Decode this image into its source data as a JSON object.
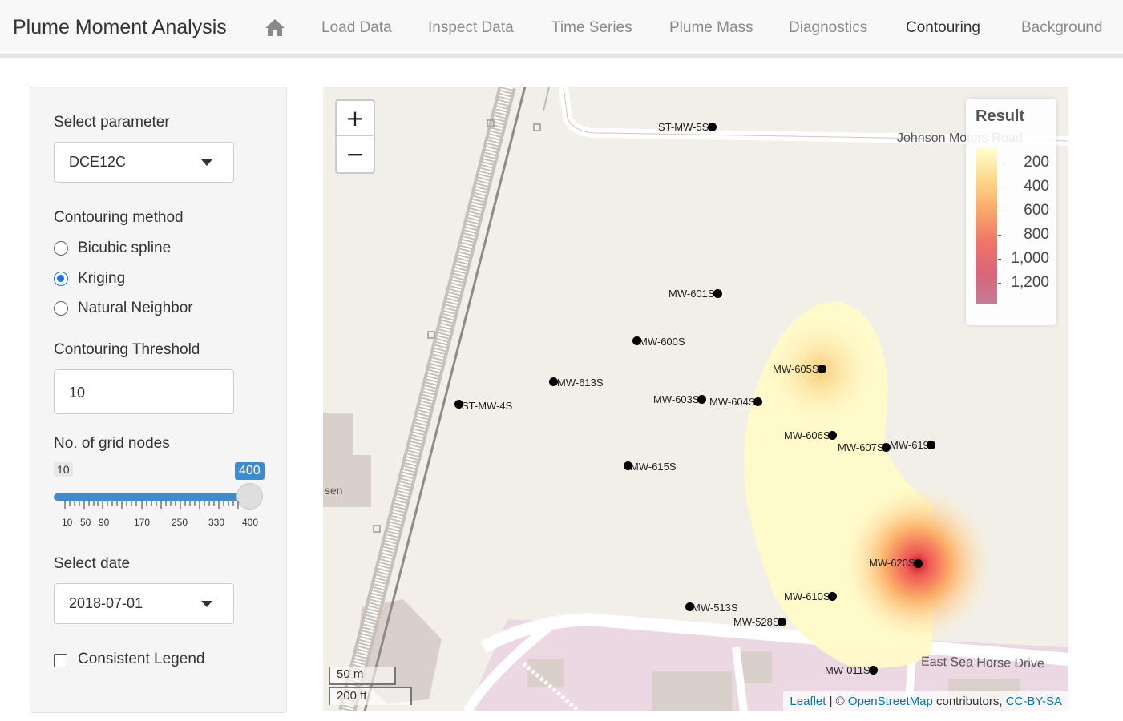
{
  "navbar": {
    "brand": "Plume Moment Analysis",
    "home_icon": "home-icon",
    "items": [
      {
        "label": "Load Data",
        "active": false
      },
      {
        "label": "Inspect Data",
        "active": false
      },
      {
        "label": "Time Series",
        "active": false
      },
      {
        "label": "Plume Mass",
        "active": false
      },
      {
        "label": "Diagnostics",
        "active": false
      },
      {
        "label": "Contouring",
        "active": true
      },
      {
        "label": "Background",
        "active": false
      }
    ]
  },
  "sidebar": {
    "parameter_label": "Select parameter",
    "parameter_value": "DCE12C",
    "method_label": "Contouring method",
    "methods": [
      {
        "label": "Bicubic spline",
        "checked": false
      },
      {
        "label": "Kriging",
        "checked": true
      },
      {
        "label": "Natural Neighbor",
        "checked": false
      }
    ],
    "threshold_label": "Contouring Threshold",
    "threshold_value": "10",
    "grid_label": "No. of grid nodes",
    "slider": {
      "min_badge": "10",
      "value_badge": "400",
      "value": 400,
      "min": 10,
      "max": 400,
      "tick_labels": [
        "10",
        "50",
        "90",
        "170",
        "250",
        "330",
        "400"
      ]
    },
    "date_label": "Select date",
    "date_value": "2018-07-01",
    "consistent_legend_label": "Consistent Legend",
    "consistent_legend_checked": false
  },
  "map": {
    "zoom_in": "+",
    "zoom_out": "−",
    "legend": {
      "title": "Result",
      "labels": [
        "200",
        "400",
        "600",
        "800",
        "1,000",
        "1,200"
      ]
    },
    "scale": {
      "metric": "50 m",
      "imperial": "200 ft"
    },
    "attribution": {
      "leaflet": "Leaflet",
      "sep": " | © ",
      "osm": "OpenStreetMap",
      "contributors": " contributors, ",
      "license": "CC-BY-SA"
    },
    "streets": {
      "johnson": "Johnson Motors Road",
      "horse": "East Sea Horse Drive",
      "partial": "sen"
    },
    "wells": [
      "ST-MW-5S",
      "MW-601S",
      "MW-600S",
      "MW-613S",
      "ST-MW-4S",
      "MW-603S",
      "MW-604S",
      "MW-605S",
      "MW-606S",
      "MW-607S",
      "MW-619S",
      "MW-615S",
      "MW-620S",
      "MW-610S",
      "MW-513S",
      "MW-528S",
      "MW-011S"
    ]
  }
}
